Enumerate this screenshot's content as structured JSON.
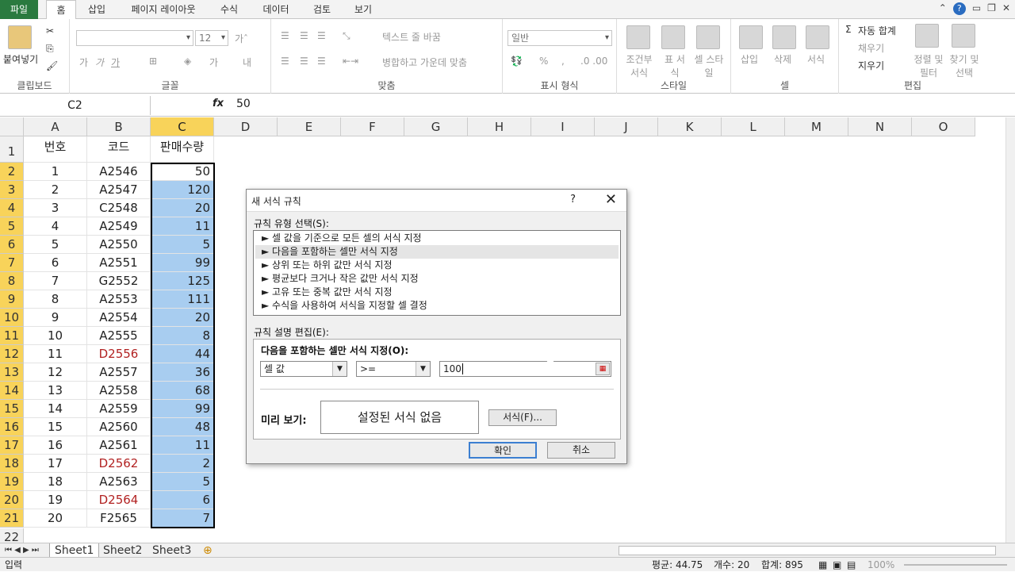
{
  "ribbon_tabs": [
    "파일",
    "홈",
    "삽입",
    "페이지 레이아웃",
    "수식",
    "데이터",
    "검토",
    "보기"
  ],
  "ribbon": {
    "clipboard": {
      "paste": "붙여넣기",
      "label": "클립보드"
    },
    "font": {
      "size": "12",
      "label": "글꼴"
    },
    "align": {
      "wrap": "텍스트 줄 바꿈",
      "merge": "병합하고 가운데 맞춤",
      "label": "맞춤"
    },
    "number": {
      "format": "일반",
      "label": "표시 형식"
    },
    "styles": {
      "cond": "조건부 서식",
      "table": "표 서식",
      "cell": "셀 스타일",
      "label": "스타일"
    },
    "cells": {
      "insert": "삽입",
      "delete": "삭제",
      "format": "서식",
      "label": "셀"
    },
    "edit": {
      "autosum": "자동 합계",
      "fill": "채우기",
      "clear": "지우기",
      "sort": "정렬 및 필터",
      "find": "찾기 및 선택",
      "label": "편집"
    }
  },
  "formula_bar": {
    "name": "C2",
    "fx": "fx",
    "value": "50"
  },
  "columns": [
    "A",
    "B",
    "C",
    "D",
    "E",
    "F",
    "G",
    "H",
    "I",
    "J",
    "K",
    "L",
    "M",
    "N",
    "O"
  ],
  "header_row": {
    "a": "번호",
    "b": "코드",
    "c": "판매수량"
  },
  "rows": [
    {
      "n": "2",
      "a": "1",
      "b": "A2546",
      "c": "50",
      "red": false
    },
    {
      "n": "3",
      "a": "2",
      "b": "A2547",
      "c": "120",
      "red": false
    },
    {
      "n": "4",
      "a": "3",
      "b": "C2548",
      "c": "20",
      "red": false
    },
    {
      "n": "5",
      "a": "4",
      "b": "A2549",
      "c": "11",
      "red": false
    },
    {
      "n": "6",
      "a": "5",
      "b": "A2550",
      "c": "5",
      "red": false
    },
    {
      "n": "7",
      "a": "6",
      "b": "A2551",
      "c": "99",
      "red": false
    },
    {
      "n": "8",
      "a": "7",
      "b": "G2552",
      "c": "125",
      "red": false
    },
    {
      "n": "9",
      "a": "8",
      "b": "A2553",
      "c": "111",
      "red": false
    },
    {
      "n": "10",
      "a": "9",
      "b": "A2554",
      "c": "20",
      "red": false
    },
    {
      "n": "11",
      "a": "10",
      "b": "A2555",
      "c": "8",
      "red": false
    },
    {
      "n": "12",
      "a": "11",
      "b": "D2556",
      "c": "44",
      "red": true
    },
    {
      "n": "13",
      "a": "12",
      "b": "A2557",
      "c": "36",
      "red": false
    },
    {
      "n": "14",
      "a": "13",
      "b": "A2558",
      "c": "68",
      "red": false
    },
    {
      "n": "15",
      "a": "14",
      "b": "A2559",
      "c": "99",
      "red": false
    },
    {
      "n": "16",
      "a": "15",
      "b": "A2560",
      "c": "48",
      "red": false
    },
    {
      "n": "17",
      "a": "16",
      "b": "A2561",
      "c": "11",
      "red": false
    },
    {
      "n": "18",
      "a": "17",
      "b": "D2562",
      "c": "2",
      "red": true
    },
    {
      "n": "19",
      "a": "18",
      "b": "A2563",
      "c": "5",
      "red": false
    },
    {
      "n": "20",
      "a": "19",
      "b": "D2564",
      "c": "6",
      "red": true
    },
    {
      "n": "21",
      "a": "20",
      "b": "F2565",
      "c": "7",
      "red": false
    }
  ],
  "sheets": [
    "Sheet1",
    "Sheet2",
    "Sheet3"
  ],
  "status": {
    "mode": "입력",
    "avg": "평균: 44.75",
    "count": "개수: 20",
    "sum": "합계: 895",
    "zoom": "100%"
  },
  "dialog": {
    "title": "새 서식 규칙",
    "help": "?",
    "rule_type_label": "규칙 유형 선택(S):",
    "rule_types": [
      "셀 값을 기준으로 모든 셀의 서식 지정",
      "다음을 포함하는 셀만 서식 지정",
      "상위 또는 하위 값만 서식 지정",
      "평균보다 크거나 작은 값만 서식 지정",
      "고유 또는 중복 값만 서식 지정",
      "수식을 사용하여 서식을 지정할 셀 결정"
    ],
    "selected_rule": 1,
    "edit_label": "규칙 설명 편집(E):",
    "edit_heading": "다음을 포함하는 셀만 서식 지정(O):",
    "condition_field": "셀 값",
    "operator": ">=",
    "value": "100",
    "preview_label": "미리 보기:",
    "preview_text": "설정된 서식 없음",
    "format_button": "서식(F)...",
    "ok": "확인",
    "cancel": "취소"
  }
}
